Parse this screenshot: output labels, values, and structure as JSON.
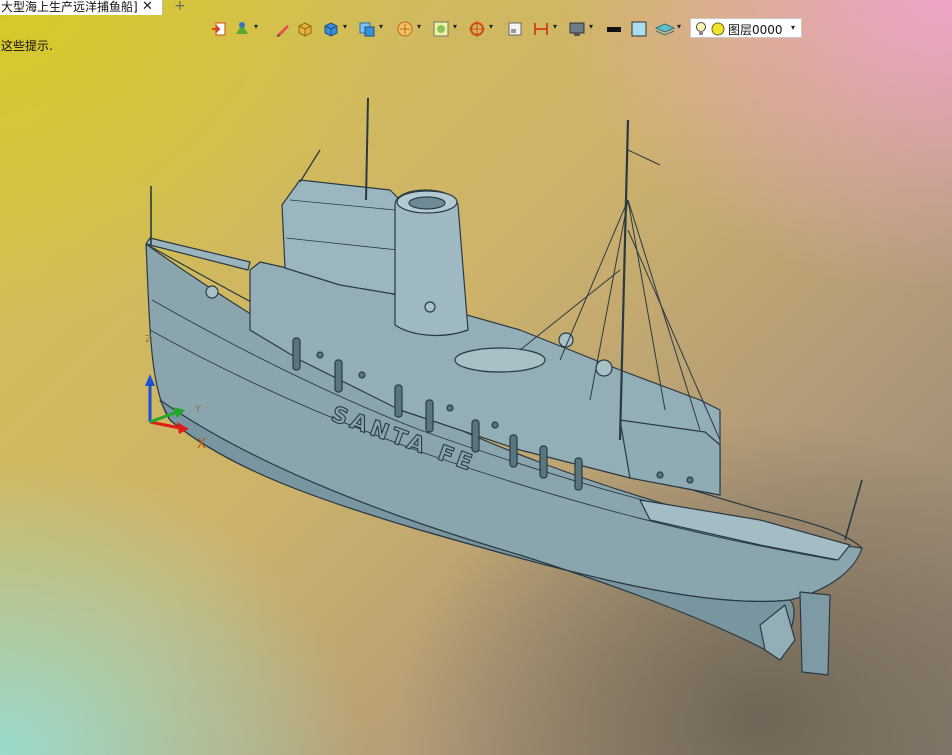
{
  "tab": {
    "title": "大型海上生产远洋捕鱼船]",
    "close_icon": "close-icon",
    "add_icon": "plus-icon"
  },
  "toolbar": {
    "layer_label": "图层0000",
    "icons": [
      "exit-sketch-icon",
      "material-icon",
      "pencil-icon",
      "solid-box-icon",
      "cube-view-icon",
      "display-mode-icon",
      "snap-icon",
      "render-icon",
      "zoom-icon",
      "plane-icon",
      "section-icon",
      "monitor-icon",
      "line-color-icon",
      "fill-color-icon",
      "layer-stack-icon",
      "lightbulb-icon",
      "layer-status-icon"
    ]
  },
  "hint": {
    "text": "这些提示."
  },
  "triad": {
    "x_label": "X",
    "y_label": "Y",
    "z_label": "Z"
  },
  "model": {
    "hull_lettering": "SANTA FE"
  },
  "colors": {
    "model_fill": "#8aa5ae",
    "model_line": "#2a3a44",
    "axis_x": "#e01b1b",
    "axis_y": "#1fa82a",
    "axis_z": "#1e4fd8"
  }
}
